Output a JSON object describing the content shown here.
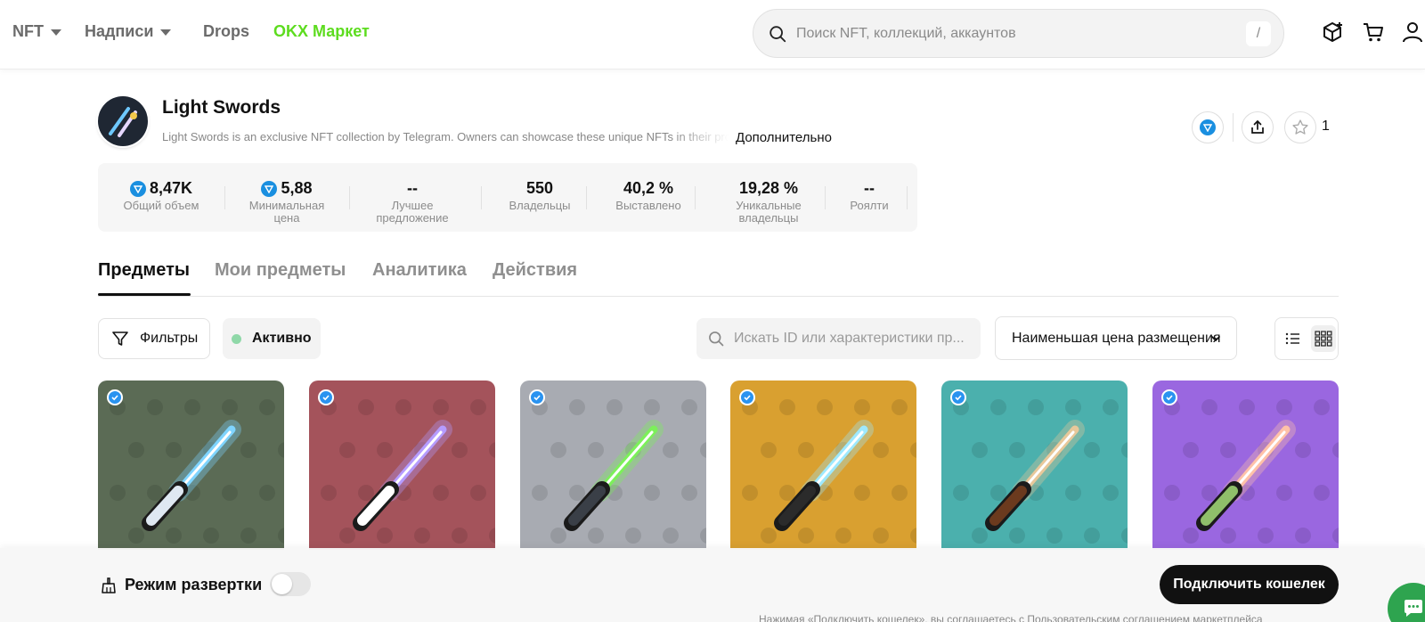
{
  "header": {
    "nav": {
      "nft": "NFT",
      "inscriptions": "Надписи",
      "drops": "Drops",
      "market": "OKX Маркет"
    },
    "search_placeholder": "Поиск NFT, коллекций, аккаунтов",
    "search_shortcut": "/"
  },
  "collection": {
    "title": "Light Swords",
    "description": "Light Swords is an exclusive NFT collection by Telegram. Owners can showcase these unique NFTs in their profiles",
    "more_link": "Дополнительно",
    "favorites_count": "1"
  },
  "stats": [
    {
      "value": "8,47K",
      "label": "Общий объем",
      "ton": true
    },
    {
      "value": "5,88",
      "label": "Минимальная цена",
      "ton": true
    },
    {
      "value": "--",
      "label": "Лучшее предложение",
      "ton": false
    },
    {
      "value": "550",
      "label": "Владельцы",
      "ton": false
    },
    {
      "value": "40,2 %",
      "label": "Выставлено",
      "ton": false
    },
    {
      "value": "19,28 %",
      "label": "Уникальные владельцы",
      "ton": false
    },
    {
      "value": "--",
      "label": "Роялти",
      "ton": false
    }
  ],
  "tabs": [
    "Предметы",
    "Мои предметы",
    "Аналитика",
    "Действия"
  ],
  "controls": {
    "filters_label": "Фильтры",
    "active_label": "Активно",
    "item_search_placeholder": "Искать ID или характеристики пр...",
    "sort_label": "Наименьшая цена размещения"
  },
  "cards": [
    {
      "bg": "#5b6b55",
      "blade": "#7fd4ff",
      "hilt": "#dfe8f2"
    },
    {
      "bg": "#a4535b",
      "blade": "#b59cff",
      "hilt": "#ffffff"
    },
    {
      "bg": "#a8abb2",
      "blade": "#7cf05a",
      "hilt": "#3a3f47"
    },
    {
      "bg": "#d9a030",
      "blade": "#9ee9ff",
      "hilt": "#2b2b2b"
    },
    {
      "bg": "#4bb0ad",
      "blade": "#e8c89a",
      "hilt": "#6b3a1e"
    },
    {
      "bg": "#9a67e0",
      "blade": "#ffc2a8",
      "hilt": "#8fbf6a"
    }
  ],
  "bottom": {
    "sweep_label": "Режим развертки",
    "connect_label": "Подключить кошелек",
    "legal_text": "Нажимая «Подключить кошелек», вы соглашаетесь с Пользовательским соглашением маркетплейса"
  },
  "colors": {
    "accent_green": "#5ddc1f",
    "ton_blue": "#1a8fe0",
    "verified_blue": "#2a93f0"
  }
}
